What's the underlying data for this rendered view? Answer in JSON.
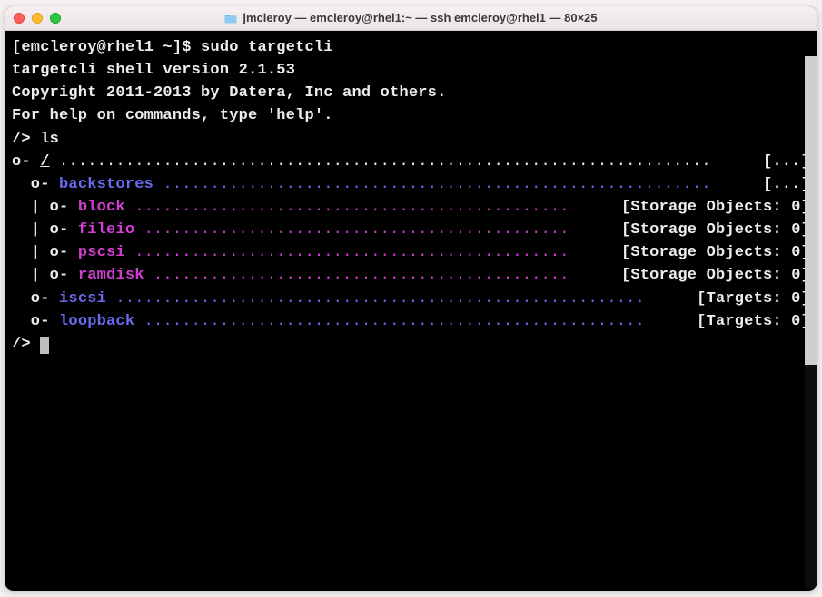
{
  "window": {
    "title": "jmcleroy — emcleroy@rhel1:~ — ssh emcleroy@rhel1 — 80×25"
  },
  "terminal": {
    "prompt1": "[emcleroy@rhel1 ~]$ ",
    "command1": "sudo targetcli",
    "welcome1": "targetcli shell version 2.1.53",
    "welcome2": "Copyright 2011-2013 by Datera, Inc and others.",
    "welcome3": "For help on commands, type 'help'.",
    "blank": "",
    "prompt2": "/> ",
    "command2": "ls",
    "tree": {
      "root_left_bold": "o- ",
      "root_slash": "/",
      "root_dots": " .....................................................................",
      "root_right": " [...]",
      "backstores_left_pre": "  o- ",
      "backstores_label": "backstores",
      "backstores_dots": " ..........................................................",
      "backstores_right": " [...]",
      "block_pre": "  | o- ",
      "block_label": "block",
      "block_dots": " ..............................................",
      "block_right": " [Storage Objects: 0]",
      "fileio_pre": "  | o- ",
      "fileio_label": "fileio",
      "fileio_dots": " .............................................",
      "fileio_right": " [Storage Objects: 0]",
      "pscsi_pre": "  | o- ",
      "pscsi_label": "pscsi",
      "pscsi_dots": " ..............................................",
      "pscsi_right": " [Storage Objects: 0]",
      "ramdisk_pre": "  | o- ",
      "ramdisk_label": "ramdisk",
      "ramdisk_dots": " ............................................",
      "ramdisk_right": " [Storage Objects: 0]",
      "iscsi_pre": "  o- ",
      "iscsi_label": "iscsi",
      "iscsi_dots": " ........................................................",
      "iscsi_right": " [Targets: 0]",
      "loopback_pre": "  o- ",
      "loopback_label": "loopback",
      "loopback_dots": " .....................................................",
      "loopback_right": " [Targets: 0]"
    },
    "prompt3": "/> "
  }
}
